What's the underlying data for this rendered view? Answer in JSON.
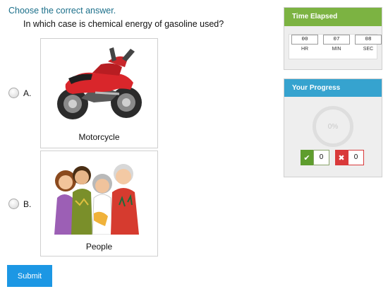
{
  "instruction": "Choose the correct answer.",
  "question": "In which case is chemical energy of gasoline used?",
  "options": [
    {
      "letter": "A.",
      "label": "Motorcycle",
      "image_icon": "motorcycle-image"
    },
    {
      "letter": "B.",
      "label": "People",
      "image_icon": "people-image"
    }
  ],
  "submit_label": "Submit",
  "timer": {
    "title": "Time Elapsed",
    "hours": "00",
    "minutes": "07",
    "seconds": "08",
    "hr_label": "HR",
    "min_label": "MIN",
    "sec_label": "SEC"
  },
  "progress": {
    "title": "Your Progress",
    "percent_text": "0%",
    "percent": 0,
    "correct_count": "0",
    "wrong_count": "0"
  },
  "colors": {
    "instruction_text": "#1b6f8a",
    "submit_button": "#1c97e4",
    "timer_header": "#7cb342",
    "progress_header": "#36a3cf",
    "correct": "#5e9d2d",
    "wrong": "#d9393a"
  }
}
